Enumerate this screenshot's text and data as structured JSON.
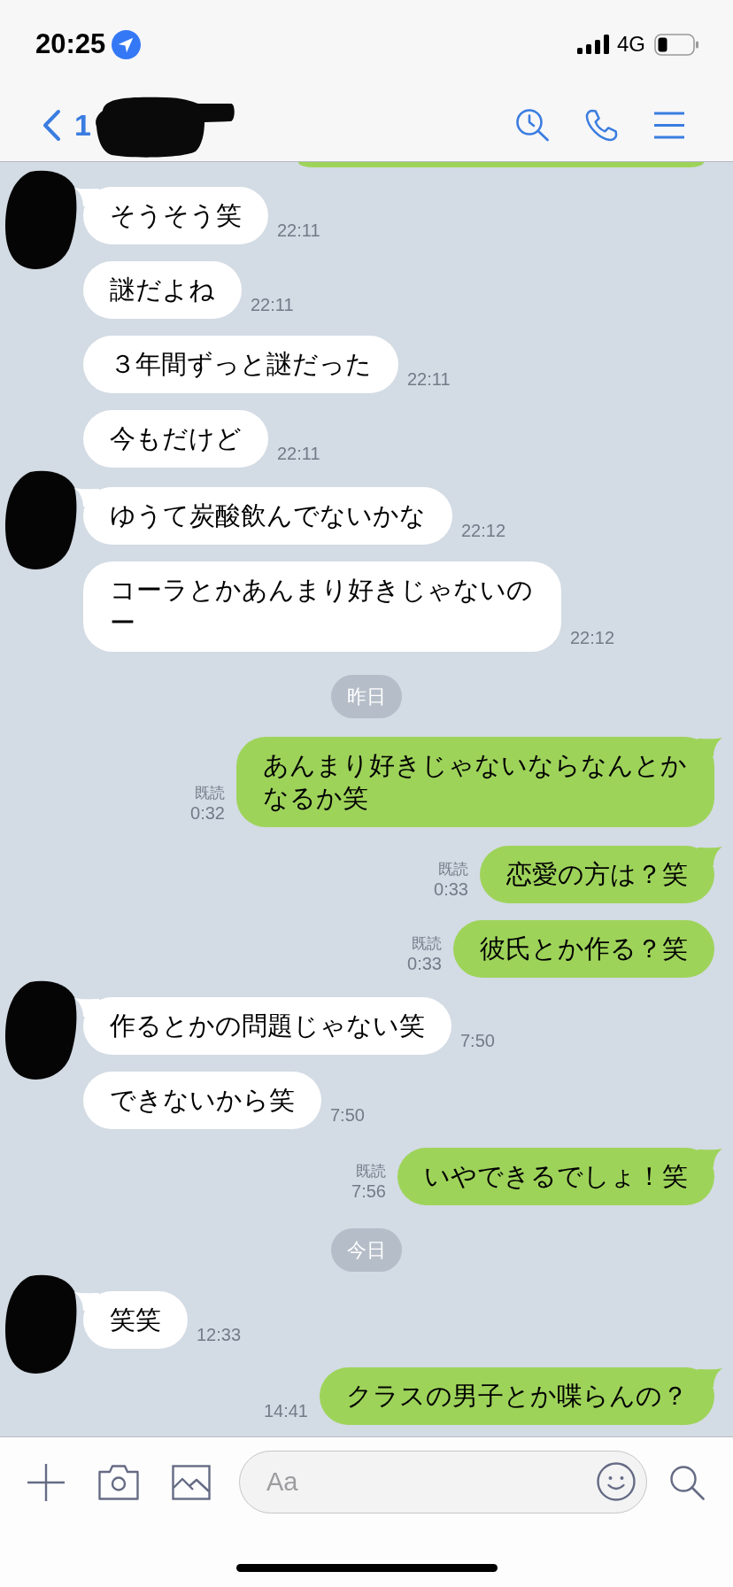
{
  "status_bar": {
    "time": "20:25",
    "network": "4G"
  },
  "header": {
    "back_label": "1"
  },
  "messages": [
    {
      "kind": "partial"
    },
    {
      "kind": "incoming",
      "first_in_group": true,
      "text": "そうそう笑",
      "time": "22:11"
    },
    {
      "kind": "incoming",
      "first_in_group": false,
      "text": "謎だよね",
      "time": "22:11"
    },
    {
      "kind": "incoming",
      "first_in_group": false,
      "text": "３年間ずっと謎だった",
      "time": "22:11"
    },
    {
      "kind": "incoming",
      "first_in_group": false,
      "text": "今もだけど",
      "time": "22:11"
    },
    {
      "kind": "incoming",
      "first_in_group": true,
      "text": "ゆうて炭酸飲んでないかな",
      "time": "22:12"
    },
    {
      "kind": "incoming",
      "first_in_group": false,
      "text": "コーラとかあんまり好きじゃないのー",
      "time": "22:12"
    },
    {
      "kind": "date",
      "text": "昨日"
    },
    {
      "kind": "outgoing",
      "first_in_group": true,
      "text": "あんまり好きじゃないならなんとかなるか笑",
      "status": "既読",
      "time": "0:32"
    },
    {
      "kind": "outgoing",
      "first_in_group": true,
      "text": "恋愛の方は？笑",
      "status": "既読",
      "time": "0:33"
    },
    {
      "kind": "outgoing",
      "first_in_group": false,
      "text": "彼氏とか作る？笑",
      "status": "既読",
      "time": "0:33"
    },
    {
      "kind": "incoming",
      "first_in_group": true,
      "text": "作るとかの問題じゃない笑",
      "time": "7:50"
    },
    {
      "kind": "incoming",
      "first_in_group": false,
      "text": "できないから笑",
      "time": "7:50"
    },
    {
      "kind": "outgoing",
      "first_in_group": true,
      "text": "いやできるでしょ！笑",
      "status": "既読",
      "time": "7:56"
    },
    {
      "kind": "date",
      "text": "今日"
    },
    {
      "kind": "incoming",
      "first_in_group": true,
      "text": "笑笑",
      "time": "12:33"
    },
    {
      "kind": "outgoing",
      "first_in_group": true,
      "text": "クラスの男子とか喋らんの？",
      "time": "14:41"
    }
  ],
  "composer": {
    "placeholder": "Aa"
  }
}
